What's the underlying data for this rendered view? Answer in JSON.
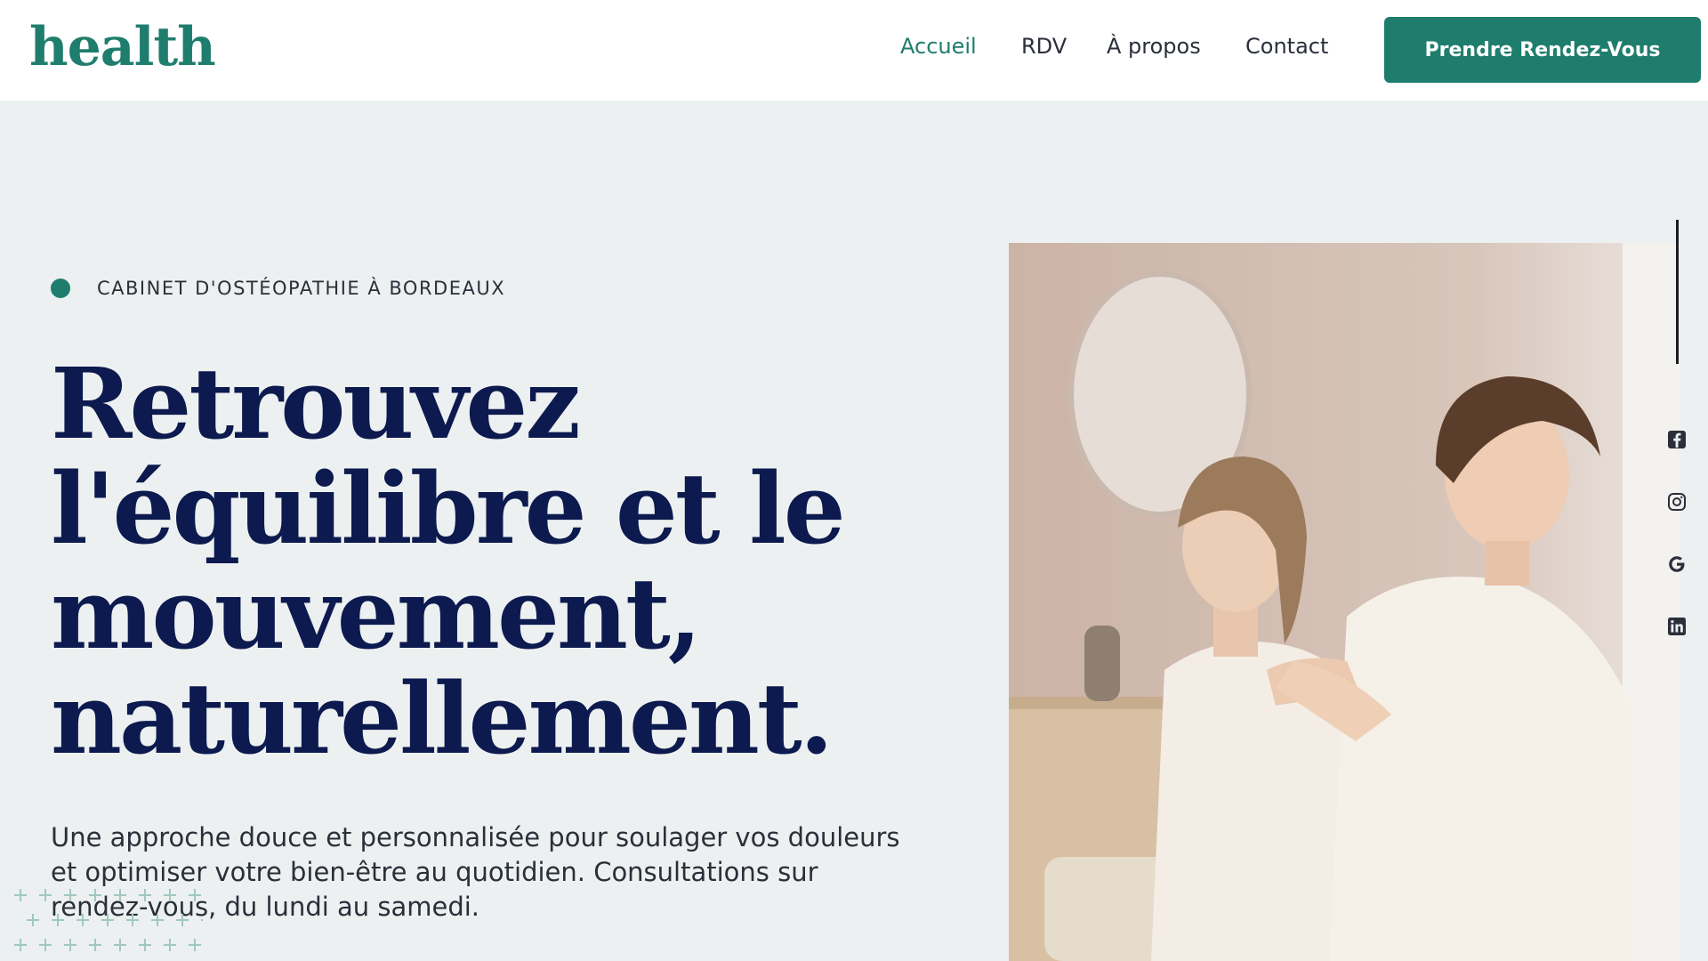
{
  "header": {
    "logo": "health",
    "nav": [
      {
        "label": "Accueil",
        "active": true
      },
      {
        "label": "RDV",
        "active": false
      },
      {
        "label": "À propos",
        "active": false
      },
      {
        "label": "Contact",
        "active": false
      }
    ],
    "cta_label": "Prendre Rendez-Vous"
  },
  "hero": {
    "eyebrow": "CABINET D'OSTÉOPATHIE À BORDEAUX",
    "headline": "Retrouvez l'équilibre et le mouvement, naturellement.",
    "subtext": "Une approche douce et personnalisée pour soulager vos douleurs et optimiser votre bien-être au quotidien. Consultations sur rendez-vous, du lundi au samedi."
  },
  "social_icons": [
    "facebook-icon",
    "instagram-icon",
    "google-icon",
    "linkedin-icon"
  ],
  "colors": {
    "accent": "#1f7d6d",
    "headline": "#0d1a4f",
    "background": "#ecf0f0",
    "text": "#2a2f3a"
  }
}
